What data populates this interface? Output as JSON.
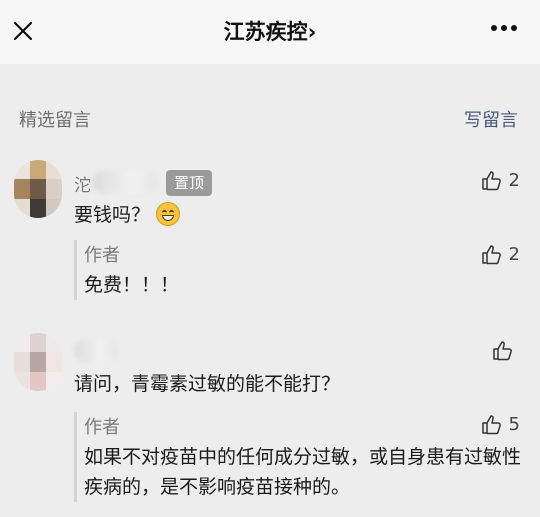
{
  "header": {
    "title": "江苏疾控",
    "title_suffix": "›"
  },
  "section": {
    "label": "精选留言",
    "write_link": "写留言"
  },
  "comments": [
    {
      "nickname_visible": "沱",
      "pinned_badge": "置顶",
      "text": "要钱吗？",
      "emoji": "grinning-face",
      "likes": "2",
      "reply": {
        "author": "作者",
        "text": "免费！！！",
        "likes": "2"
      }
    },
    {
      "nickname_visible": "",
      "text": "请问，青霉素过敏的能不能打？",
      "likes": "",
      "reply": {
        "author": "作者",
        "text": "如果不对疫苗中的任何成分过敏，或自身患有过敏性疾病的，是不影响疫苗接种的。",
        "likes": "5"
      }
    }
  ],
  "colors": {
    "top_bar": "#f7f7f7",
    "background": "#ededed",
    "link": "#4a5a7a",
    "badge": "#9a9a9a"
  }
}
